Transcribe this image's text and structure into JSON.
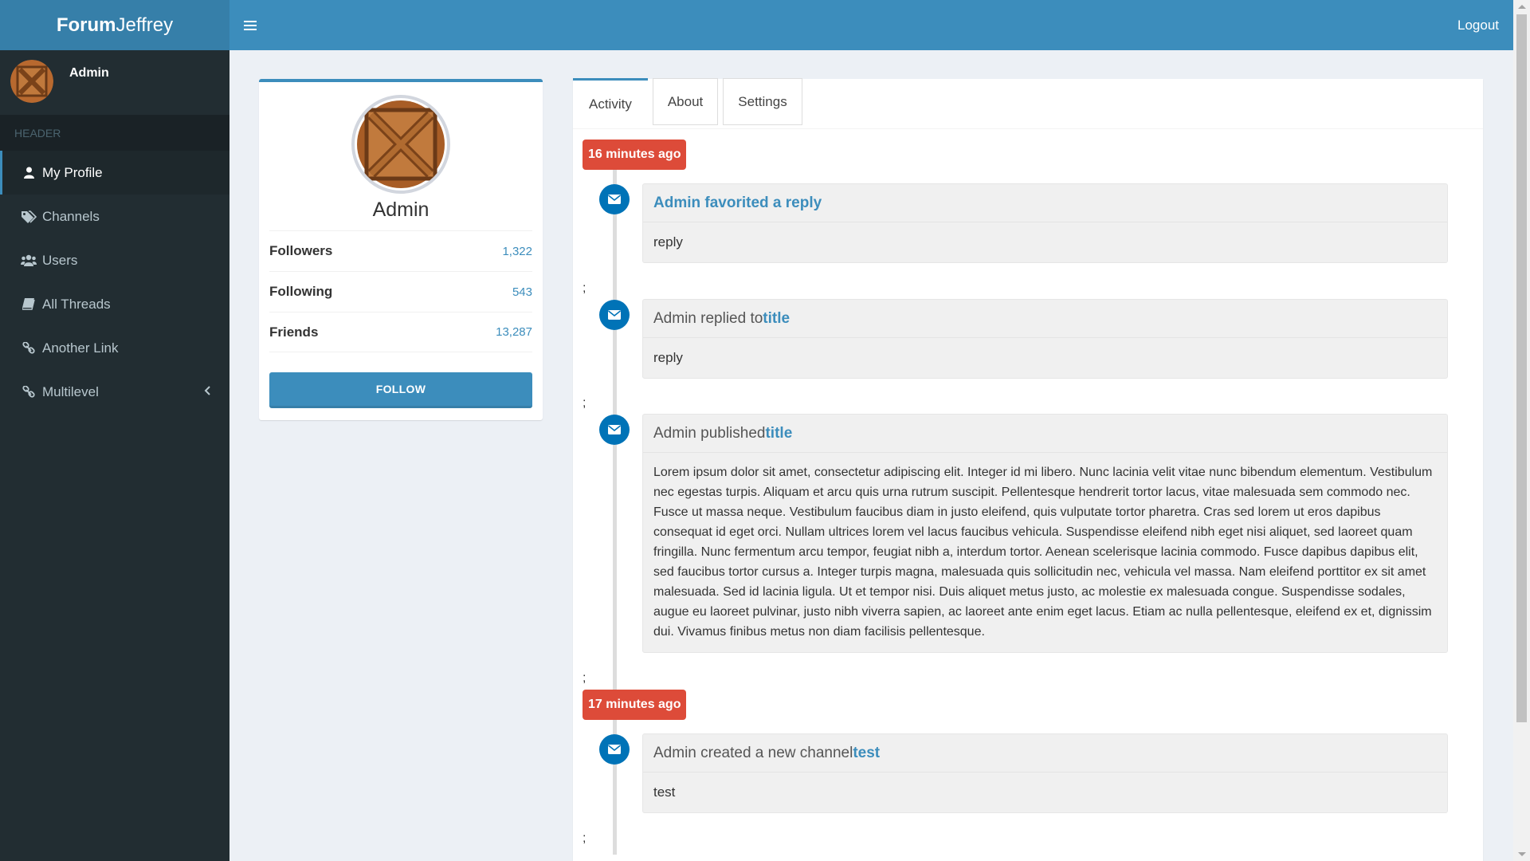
{
  "app": {
    "logo_bold": "Forum",
    "logo_light": "Jeffrey",
    "logout_label": "Logout"
  },
  "sidebar": {
    "user_name": "Admin",
    "header_label": "HEADER",
    "items": [
      {
        "label": "My Profile",
        "icon": "user-icon",
        "active": true
      },
      {
        "label": "Channels",
        "icon": "tags-icon"
      },
      {
        "label": "Users",
        "icon": "users-icon"
      },
      {
        "label": "All Threads",
        "icon": "book-icon"
      },
      {
        "label": "Another Link",
        "icon": "link-icon"
      },
      {
        "label": "Multilevel",
        "icon": "link-icon",
        "expandable": true
      }
    ]
  },
  "profile": {
    "name": "Admin",
    "stats": [
      {
        "label": "Followers",
        "value": "1,322"
      },
      {
        "label": "Following",
        "value": "543"
      },
      {
        "label": "Friends",
        "value": "13,287"
      }
    ],
    "follow_label": "FOLLOW"
  },
  "tabs": [
    {
      "label": "Activity",
      "active": true
    },
    {
      "label": "About"
    },
    {
      "label": "Settings"
    }
  ],
  "timeline": {
    "groups": [
      {
        "time": "16 minutes ago"
      },
      {
        "time": "17 minutes ago"
      }
    ],
    "items": [
      {
        "prefix": "",
        "link": "Admin favorited a reply",
        "body": "reply"
      },
      {
        "prefix": "Admin replied to ",
        "link": "title",
        "body": "reply"
      },
      {
        "prefix": "Admin published ",
        "link": "title",
        "body": "Lorem ipsum dolor sit amet, consectetur adipiscing elit. Integer id mi libero. Nunc lacinia velit vitae nunc bibendum elementum. Vestibulum nec egestas turpis. Aliquam et arcu quis urna rutrum suscipit. Pellentesque hendrerit tortor lacus, vitae malesuada sem commodo nec. Fusce ut massa neque. Vestibulum faucibus diam in justo eleifend, quis vulputate tortor pharetra. Cras sed lorem ut eros dapibus consequat id eget orci. Nullam ultrices lorem vel lacus faucibus vehicula. Suspendisse eleifend nibh eget nisi aliquet, sed laoreet quam fringilla. Nunc fermentum arcu tempor, feugiat nibh a, interdum tortor. Aenean scelerisque lacinia commodo. Fusce dapibus dapibus elit, sed faucibus tortor cursus a. Integer turpis magna, malesuada quis sollicitudin nec, vehicula vel massa. Nam eleifend porttitor ex sit amet malesuada. Sed id lacinia ligula. Ut et tempor nisi. Duis aliquet metus justo, ac molestie ex malesuada congue. Suspendisse sodales, augue eu laoreet pulvinar, justo nibh viverra sapien, ac laoreet ante enim eget lacus. Etiam ac nulla pellentesque, eleifend ex et, dignissim dui. Vivamus finibus metus non diam facilisis pellentesque."
      },
      {
        "prefix": "Admin created a new channel ",
        "link": "test",
        "body": "test"
      }
    ],
    "separator": ";"
  },
  "colors": {
    "brand": "#3c8dbc",
    "brand_dark": "#367fa9",
    "sidebar_bg": "#222d32",
    "time_label": "#dd4b39",
    "timeline_icon": "#0073b7"
  }
}
